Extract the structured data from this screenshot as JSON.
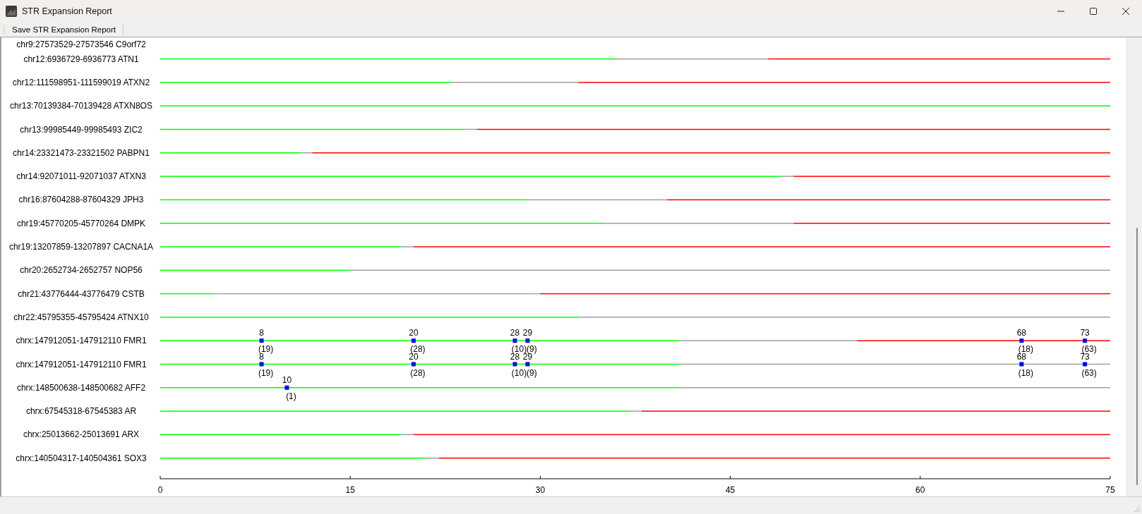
{
  "window": {
    "title": "STR Expansion Report"
  },
  "toolbar": {
    "buttons": [
      "Save STR Expansion Report"
    ]
  },
  "chart": {
    "chart_data": {
      "type": "bar",
      "orientation": "horizontal",
      "stacked": true,
      "categories": [
        "chr9:27573529-27573546 C9orf72",
        "chr12:6936729-6936773 ATN1",
        "chr12:111598951-111599019 ATXN2",
        "chr13:70139384-70139428 ATXN8OS",
        "chr13:99985449-99985493 ZIC2",
        "chr14:23321473-23321502 PABPN1",
        "chr14:92071011-92071037 ATXN3",
        "chr16:87604288-87604329 JPH3",
        "chr19:45770205-45770264 DMPK",
        "chr19:13207859-13207897 CACNA1A",
        "chr20:2652734-2652757 NOP56",
        "chr21:43776444-43776479 CSTB",
        "chr22:45795355-45795424 ATNX10",
        "chrx:147912051-147912110 FMR1",
        "chrx:147912051-147912110 FMR1",
        "chrx:148500638-148500682 AFF2",
        "chrx:67545318-67545383 AR",
        "chrx:25013662-25013691 ARX",
        "chrx:140504317-140504361 SOX3"
      ],
      "series": [
        {
          "color": "#00ff00",
          "values": [
            null,
            36,
            23,
            75,
            24,
            11,
            49,
            29,
            35,
            19,
            15,
            4,
            33,
            41,
            41,
            41,
            37,
            19,
            21
          ]
        },
        {
          "color": "#a0a0a0",
          "values": [
            null,
            12,
            10,
            0,
            1,
            1,
            1,
            11,
            15,
            1,
            60,
            26,
            42,
            14,
            34,
            34,
            1,
            1,
            1
          ]
        },
        {
          "color": "#ff0000",
          "values": [
            null,
            27,
            42,
            0,
            50,
            63,
            25,
            35,
            25,
            55,
            0,
            45,
            0,
            20,
            0,
            0,
            37,
            55,
            53
          ]
        }
      ],
      "xlim": [
        0,
        75
      ],
      "xticks": [
        0,
        15,
        30,
        45,
        60,
        75
      ],
      "annotations": [
        {
          "x": 8,
          "y": "chrx:147912051-147912110 FMR1",
          "text": "8\n(19)"
        },
        {
          "x": 20,
          "y": "chrx:147912051-147912110 FMR1",
          "text": "20\n(28)"
        },
        {
          "x": 28,
          "y": "chrx:147912051-147912110 FMR1",
          "text": "28\n(10)"
        },
        {
          "x": 29,
          "y": "chrx:147912051-147912110 FMR1",
          "text": "29\n(9)"
        },
        {
          "x": 68,
          "y": "chrx:147912051-147912110 FMR1",
          "text": "68\n(18)"
        },
        {
          "x": 73,
          "y": "chrx:147912051-147912110 FMR1",
          "text": "73\n(63)"
        },
        {
          "x": 8,
          "y": "chrx:147912051-147912110 FMR1",
          "text": "8\n(19)"
        },
        {
          "x": 20,
          "y": "chrx:147912051-147912110 FMR1",
          "text": "20\n(28)"
        },
        {
          "x": 28,
          "y": "chrx:147912051-147912110 FMR1",
          "text": "28\n(10)"
        },
        {
          "x": 29,
          "y": "chrx:147912051-147912110 FMR1",
          "text": "29\n(9)"
        },
        {
          "x": 68,
          "y": "chrx:147912051-147912110 FMR1",
          "text": "68\n(18)"
        },
        {
          "x": 73,
          "y": "chrx:147912051-147912110 FMR1",
          "text": "73\n(63)"
        },
        {
          "x": 10,
          "y": "chrx:148500638-148500682 AFF2",
          "text": "10\n(1)"
        }
      ]
    }
  }
}
